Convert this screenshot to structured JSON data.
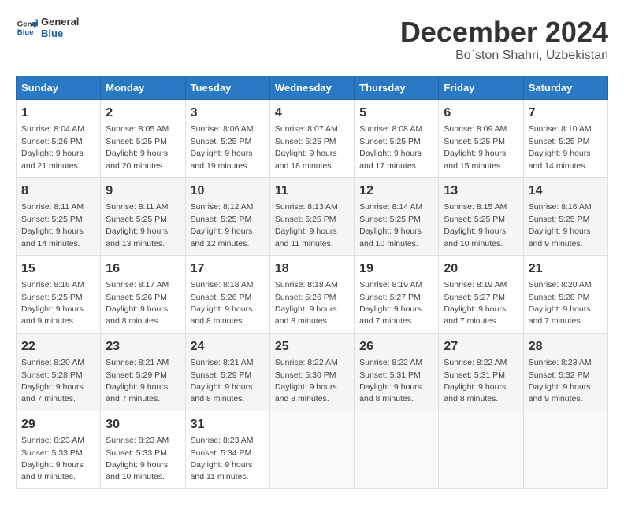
{
  "header": {
    "logo_general": "General",
    "logo_blue": "Blue",
    "title": "December 2024",
    "subtitle": "Bo`ston Shahri, Uzbekistan"
  },
  "calendar": {
    "days_of_week": [
      "Sunday",
      "Monday",
      "Tuesday",
      "Wednesday",
      "Thursday",
      "Friday",
      "Saturday"
    ],
    "weeks": [
      [
        {
          "day": "1",
          "info": "Sunrise: 8:04 AM\nSunset: 5:26 PM\nDaylight: 9 hours and 21 minutes."
        },
        {
          "day": "2",
          "info": "Sunrise: 8:05 AM\nSunset: 5:25 PM\nDaylight: 9 hours and 20 minutes."
        },
        {
          "day": "3",
          "info": "Sunrise: 8:06 AM\nSunset: 5:25 PM\nDaylight: 9 hours and 19 minutes."
        },
        {
          "day": "4",
          "info": "Sunrise: 8:07 AM\nSunset: 5:25 PM\nDaylight: 9 hours and 18 minutes."
        },
        {
          "day": "5",
          "info": "Sunrise: 8:08 AM\nSunset: 5:25 PM\nDaylight: 9 hours and 17 minutes."
        },
        {
          "day": "6",
          "info": "Sunrise: 8:09 AM\nSunset: 5:25 PM\nDaylight: 9 hours and 15 minutes."
        },
        {
          "day": "7",
          "info": "Sunrise: 8:10 AM\nSunset: 5:25 PM\nDaylight: 9 hours and 14 minutes."
        }
      ],
      [
        {
          "day": "8",
          "info": "Sunrise: 8:11 AM\nSunset: 5:25 PM\nDaylight: 9 hours and 14 minutes."
        },
        {
          "day": "9",
          "info": "Sunrise: 8:11 AM\nSunset: 5:25 PM\nDaylight: 9 hours and 13 minutes."
        },
        {
          "day": "10",
          "info": "Sunrise: 8:12 AM\nSunset: 5:25 PM\nDaylight: 9 hours and 12 minutes."
        },
        {
          "day": "11",
          "info": "Sunrise: 8:13 AM\nSunset: 5:25 PM\nDaylight: 9 hours and 11 minutes."
        },
        {
          "day": "12",
          "info": "Sunrise: 8:14 AM\nSunset: 5:25 PM\nDaylight: 9 hours and 10 minutes."
        },
        {
          "day": "13",
          "info": "Sunrise: 8:15 AM\nSunset: 5:25 PM\nDaylight: 9 hours and 10 minutes."
        },
        {
          "day": "14",
          "info": "Sunrise: 8:16 AM\nSunset: 5:25 PM\nDaylight: 9 hours and 9 minutes."
        }
      ],
      [
        {
          "day": "15",
          "info": "Sunrise: 8:16 AM\nSunset: 5:25 PM\nDaylight: 9 hours and 9 minutes."
        },
        {
          "day": "16",
          "info": "Sunrise: 8:17 AM\nSunset: 5:26 PM\nDaylight: 9 hours and 8 minutes."
        },
        {
          "day": "17",
          "info": "Sunrise: 8:18 AM\nSunset: 5:26 PM\nDaylight: 9 hours and 8 minutes."
        },
        {
          "day": "18",
          "info": "Sunrise: 8:18 AM\nSunset: 5:26 PM\nDaylight: 9 hours and 8 minutes."
        },
        {
          "day": "19",
          "info": "Sunrise: 8:19 AM\nSunset: 5:27 PM\nDaylight: 9 hours and 7 minutes."
        },
        {
          "day": "20",
          "info": "Sunrise: 8:19 AM\nSunset: 5:27 PM\nDaylight: 9 hours and 7 minutes."
        },
        {
          "day": "21",
          "info": "Sunrise: 8:20 AM\nSunset: 5:28 PM\nDaylight: 9 hours and 7 minutes."
        }
      ],
      [
        {
          "day": "22",
          "info": "Sunrise: 8:20 AM\nSunset: 5:28 PM\nDaylight: 9 hours and 7 minutes."
        },
        {
          "day": "23",
          "info": "Sunrise: 8:21 AM\nSunset: 5:29 PM\nDaylight: 9 hours and 7 minutes."
        },
        {
          "day": "24",
          "info": "Sunrise: 8:21 AM\nSunset: 5:29 PM\nDaylight: 9 hours and 8 minutes."
        },
        {
          "day": "25",
          "info": "Sunrise: 8:22 AM\nSunset: 5:30 PM\nDaylight: 9 hours and 8 minutes."
        },
        {
          "day": "26",
          "info": "Sunrise: 8:22 AM\nSunset: 5:31 PM\nDaylight: 9 hours and 8 minutes."
        },
        {
          "day": "27",
          "info": "Sunrise: 8:22 AM\nSunset: 5:31 PM\nDaylight: 9 hours and 8 minutes."
        },
        {
          "day": "28",
          "info": "Sunrise: 8:23 AM\nSunset: 5:32 PM\nDaylight: 9 hours and 9 minutes."
        }
      ],
      [
        {
          "day": "29",
          "info": "Sunrise: 8:23 AM\nSunset: 5:33 PM\nDaylight: 9 hours and 9 minutes."
        },
        {
          "day": "30",
          "info": "Sunrise: 8:23 AM\nSunset: 5:33 PM\nDaylight: 9 hours and 10 minutes."
        },
        {
          "day": "31",
          "info": "Sunrise: 8:23 AM\nSunset: 5:34 PM\nDaylight: 9 hours and 11 minutes."
        },
        null,
        null,
        null,
        null
      ]
    ]
  }
}
